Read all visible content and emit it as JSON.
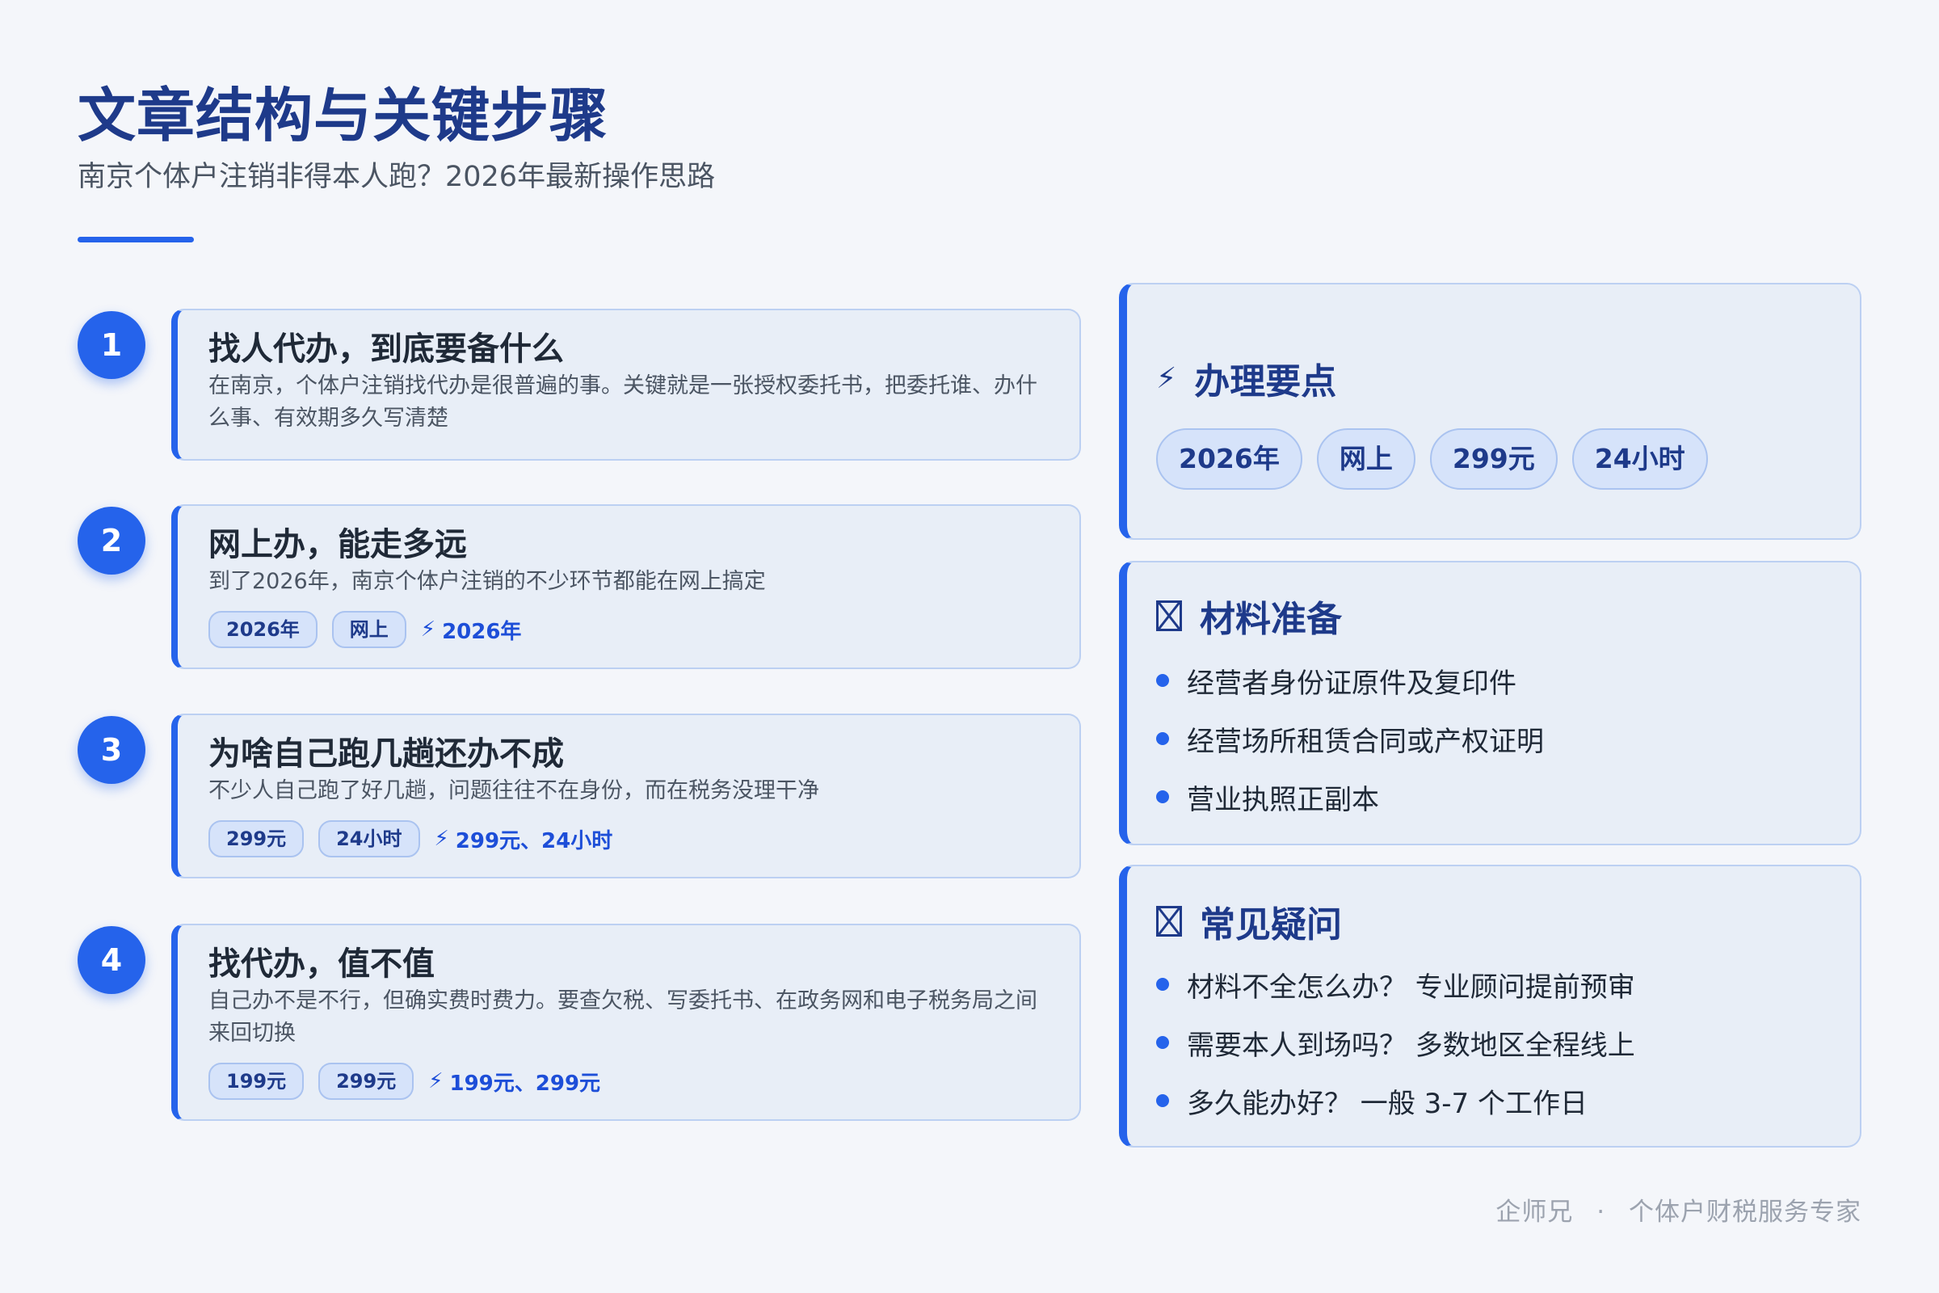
{
  "header": {
    "title": "文章结构与关键步骤",
    "subtitle": "南京个体户注销非得本人跑？2026年最新操作思路"
  },
  "steps": [
    {
      "number": "1",
      "title": "找人代办，到底要备什么",
      "desc": "在南京，个体户注销找代办是很普遍的事。关键就是一张授权委托书，把委托谁、办什么事、有效期多久写清楚",
      "tags": [],
      "note": ""
    },
    {
      "number": "2",
      "title": "网上办，能走多远",
      "desc": "到了2026年，南京个体户注销的不少环节都能在网上搞定",
      "tags": [
        "2026年",
        "网上"
      ],
      "note": "2026年"
    },
    {
      "number": "3",
      "title": "为啥自己跑几趟还办不成",
      "desc": "不少人自己跑了好几趟，问题往往不在身份，而在税务没理干净",
      "tags": [
        "299元",
        "24小时"
      ],
      "note": "299元、24小时"
    },
    {
      "number": "4",
      "title": "找代办，值不值",
      "desc": "自己办不是不行，但确实费时费力。要查欠税、写委托书、在政务网和电子税务局之间来回切换",
      "tags": [
        "199元",
        "299元"
      ],
      "note": "199元、299元"
    }
  ],
  "key_points": {
    "icon": "lightning-icon",
    "title": "办理要点",
    "pills": [
      "2026年",
      "网上",
      "299元",
      "24小时"
    ]
  },
  "materials": {
    "icon": "missing-glyph-icon",
    "title": "材料准备",
    "items": [
      "经营者身份证原件及复印件",
      "经营场所租赁合同或产权证明",
      "营业执照正副本"
    ]
  },
  "faq": {
    "icon": "missing-glyph-icon",
    "title": "常见疑问",
    "items": [
      "材料不全怎么办？ 专业顾问提前预审",
      "需要本人到场吗？ 多数地区全程线上",
      "多久能办好？ 一般 3-7 个工作日"
    ]
  },
  "footer": {
    "brand": "企师兄",
    "separator": "·",
    "tagline": "个体户财税服务专家"
  },
  "colors": {
    "accent": "#2563eb",
    "heading": "#1e3a8a",
    "card_bg": "#e8eef7",
    "page_bg": "#f4f6fa"
  }
}
